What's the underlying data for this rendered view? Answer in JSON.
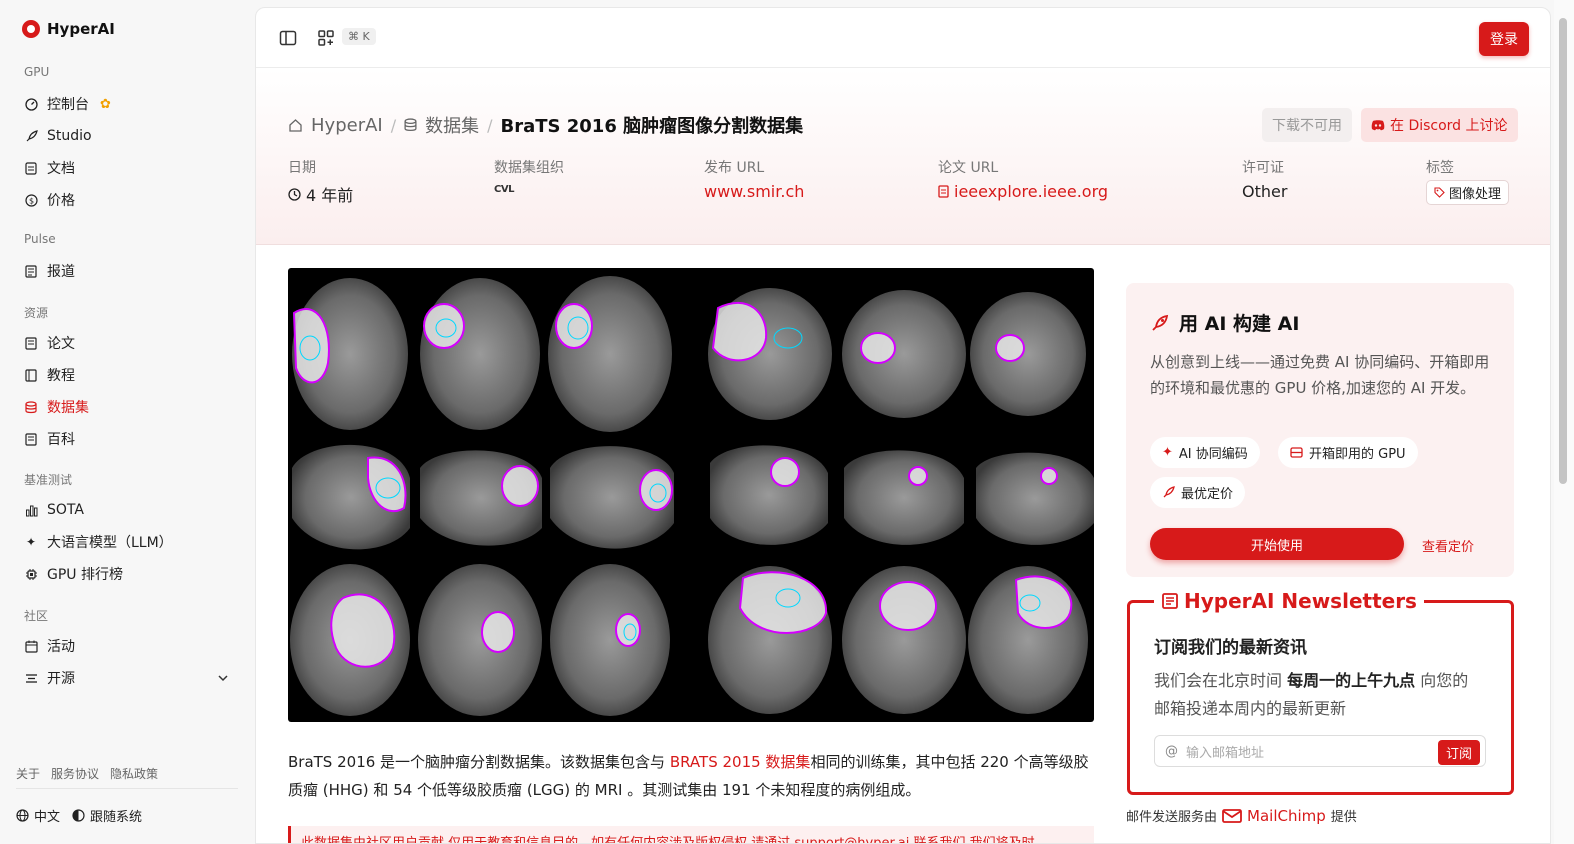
{
  "app": {
    "name": "HyperAI"
  },
  "sidebar": {
    "sections": [
      {
        "label": "GPU",
        "items": [
          {
            "label": "控制台",
            "icon": "dashboard-icon"
          },
          {
            "label": "Studio",
            "icon": "rocket-icon"
          },
          {
            "label": "文档",
            "icon": "doc-icon"
          },
          {
            "label": "价格",
            "icon": "price-icon"
          }
        ]
      },
      {
        "label": "Pulse",
        "items": [
          {
            "label": "报道",
            "icon": "news-icon"
          }
        ]
      },
      {
        "label": "资源",
        "items": [
          {
            "label": "论文",
            "icon": "paper-icon"
          },
          {
            "label": "教程",
            "icon": "book-icon"
          },
          {
            "label": "数据集",
            "icon": "database-icon",
            "active": true
          },
          {
            "label": "百科",
            "icon": "wiki-icon"
          }
        ]
      },
      {
        "label": "基准测试",
        "items": [
          {
            "label": "SOTA",
            "icon": "chart-icon"
          },
          {
            "label": "大语言模型（LLM）",
            "icon": "sparkle-icon"
          },
          {
            "label": "GPU 排行榜",
            "icon": "chip-icon"
          }
        ]
      },
      {
        "label": "社区",
        "items": [
          {
            "label": "活动",
            "icon": "calendar-icon"
          },
          {
            "label": "开源",
            "icon": "opensource-icon"
          }
        ]
      }
    ],
    "footer_links": [
      "关于",
      "服务协议",
      "隐私政策"
    ],
    "language": "中文",
    "theme": "跟随系统"
  },
  "topbar": {
    "shortcut": "⌘ K",
    "login_label": "登录"
  },
  "breadcrumb": {
    "home": "HyperAI",
    "section": "数据集",
    "title": "BraTS 2016 脑肿瘤图像分割数据集"
  },
  "actions": {
    "download_label": "下载不可用",
    "discord_label": "在 Discord 上讨论"
  },
  "meta": {
    "date_label": "日期",
    "date_value": "4 年前",
    "org_label": "数据集组织",
    "org_logo_text": "CVL",
    "release_label": "发布 URL",
    "release_value": "www.smir.ch",
    "paper_label": "论文 URL",
    "paper_value": "ieeexplore.ieee.org",
    "license_label": "许可证",
    "license_value": "Other",
    "tags_label": "标签",
    "tag_value": "图像处理"
  },
  "description": {
    "part1": "BraTS 2016 是一个脑肿瘤分割数据集。该数据集包含与 ",
    "link": "BRATS 2015 数据集",
    "part2": "相同的训练集，其中包括 220 个高等级胶质瘤 (HHG) 和 54 个低等级胶质瘤 (LGG) 的 MRI 。其测试集由 191 个未知程度的病例组成。",
    "notice": "此数据集由社区用户贡献,仅用于教育和信息目的，如有任何内容涉及版权侵权,请通过 support@hyper.ai 联系我们,我们将及时"
  },
  "promo": {
    "title": "用 AI 构建 AI",
    "text": "从创意到上线——通过免费 AI 协同编码、开箱即用的环境和最优惠的 GPU 价格,加速您的 AI 开发。",
    "pills": [
      "AI 协同编码",
      "开箱即用的 GPU",
      "最优定价"
    ],
    "start_label": "开始使用",
    "pricing_label": "查看定价"
  },
  "newsletter": {
    "title": "HyperAI Newsletters",
    "subtitle": "订阅我们的最新资讯",
    "text_pre": "我们会在北京时间 ",
    "text_bold": "每周一的上午九点",
    "text_post": " 向您的邮箱投递本周内的最新更新",
    "placeholder": "输入邮箱地址",
    "subscribe_label": "订阅",
    "powered_pre": "邮件发送服务由",
    "powered_name": "MailChimp",
    "powered_post": "提供"
  },
  "colors": {
    "accent": "#d71a1a"
  }
}
